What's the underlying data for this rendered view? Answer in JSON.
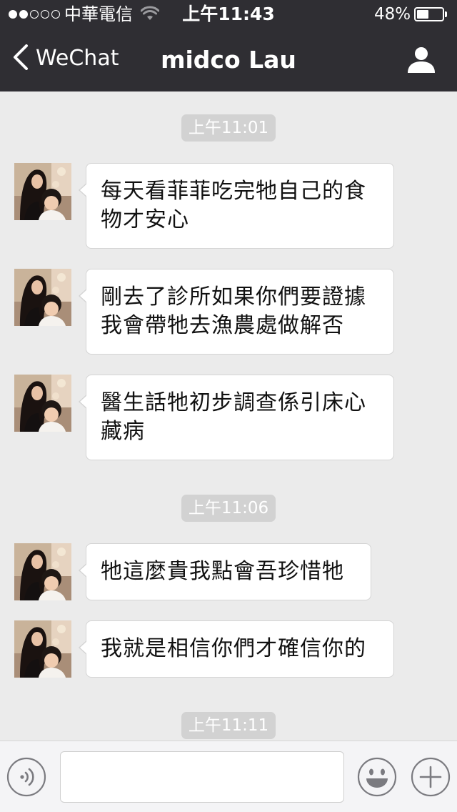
{
  "status_bar": {
    "carrier": "中華電信",
    "time": "上午11:43",
    "battery_percent": "48%",
    "battery_level": 0.48,
    "signal_strength": 2
  },
  "nav": {
    "back_label": "WeChat",
    "title": "midco Lau",
    "back_icon": "chevron-left-icon",
    "profile_icon": "person-icon"
  },
  "chat": {
    "timestamps": [
      "上午11:01",
      "上午11:06",
      "上午11:11"
    ],
    "messages": [
      {
        "text": "每天看菲菲吃完牠自己的食物才安心"
      },
      {
        "text": "剛去了診所如果你們要證據我會帶牠去漁農處做解否"
      },
      {
        "text": "醫生話牠初步調查係引床心藏病"
      },
      {
        "text": "牠這麼貴我點會吾珍惜牠"
      },
      {
        "text": "我就是相信你們才確信你的"
      }
    ]
  },
  "input_bar": {
    "text_value": "",
    "voice_icon": "voice-icon",
    "emoji_icon": "emoji-icon",
    "plus_icon": "plus-icon"
  },
  "colors": {
    "nav_background": "#2f2e33",
    "chat_background": "#ebebeb",
    "timestamp_background": "#d2d2d2",
    "bubble_background": "#ffffff"
  }
}
